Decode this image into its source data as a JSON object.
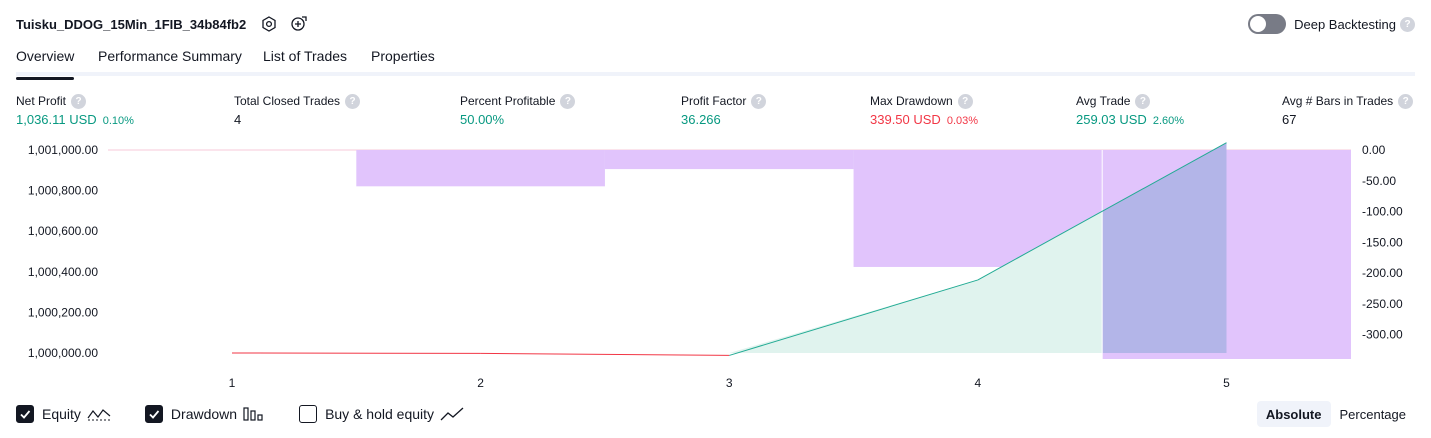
{
  "header": {
    "strategy_name": "Tuisku_DDOG_15Min_1FIB_34b84fb2",
    "settings_icon": "settings-hex-icon",
    "export_icon": "export-report-icon"
  },
  "deep_backtesting": {
    "label": "Deep Backtesting",
    "enabled": false,
    "help": "?"
  },
  "tabs": [
    {
      "label": "Overview",
      "active": true
    },
    {
      "label": "Performance Summary",
      "active": false
    },
    {
      "label": "List of Trades",
      "active": false
    },
    {
      "label": "Properties",
      "active": false
    }
  ],
  "metrics": {
    "net_profit": {
      "label": "Net Profit",
      "value": "1,036.11 USD",
      "sub": "0.10%"
    },
    "total_closed_trades": {
      "label": "Total Closed Trades",
      "value": "4"
    },
    "percent_profitable": {
      "label": "Percent Profitable",
      "value": "50.00%"
    },
    "profit_factor": {
      "label": "Profit Factor",
      "value": "36.266"
    },
    "max_drawdown": {
      "label": "Max Drawdown",
      "value": "339.50 USD",
      "sub": "0.03%"
    },
    "avg_trade": {
      "label": "Avg Trade",
      "value": "259.03 USD",
      "sub": "2.60%"
    },
    "avg_bars": {
      "label": "Avg # Bars in Trades",
      "value": "67"
    }
  },
  "chart_data": {
    "type": "line",
    "x": [
      1,
      2,
      3,
      4,
      5
    ],
    "equity": [
      1000000.0,
      999998.0,
      999988.0,
      1000360.0,
      1001036.11
    ],
    "drawdown_bars": [
      {
        "trade": 2,
        "value": -59.0
      },
      {
        "trade": 3,
        "value": -31.0
      },
      {
        "trade": 4,
        "value": -190.0
      },
      {
        "trade": 5,
        "value": -339.5
      }
    ],
    "y_left_ticks": [
      "1,001,000.00",
      "1,000,800.00",
      "1,000,600.00",
      "1,000,400.00",
      "1,000,200.00",
      "1,000,000.00"
    ],
    "y_left_values": [
      1001000,
      1000800,
      1000600,
      1000400,
      1000200,
      1000000
    ],
    "y_right_ticks": [
      "0.00",
      "-50.00",
      "-100.00",
      "-150.00",
      "-200.00",
      "-250.00",
      "-300.00"
    ],
    "y_right_values": [
      0,
      -50,
      -100,
      -150,
      -200,
      -250,
      -300
    ],
    "x_ticks": [
      "1",
      "2",
      "3",
      "4",
      "5"
    ],
    "colors": {
      "equity_up": "#22ab94",
      "equity_down": "#f23645",
      "equity_fill": "#e0f3ee",
      "drawdown": "#e1c4fc",
      "overlap": "#b3b5e8"
    }
  },
  "legend": [
    {
      "label": "Equity",
      "checked": true,
      "icon": "equity-line-icon"
    },
    {
      "label": "Drawdown",
      "checked": true,
      "icon": "drawdown-bars-icon"
    },
    {
      "label": "Buy & hold equity",
      "checked": false,
      "icon": "buy-hold-line-icon"
    }
  ],
  "modes": [
    {
      "label": "Absolute",
      "active": true
    },
    {
      "label": "Percentage",
      "active": false
    }
  ]
}
